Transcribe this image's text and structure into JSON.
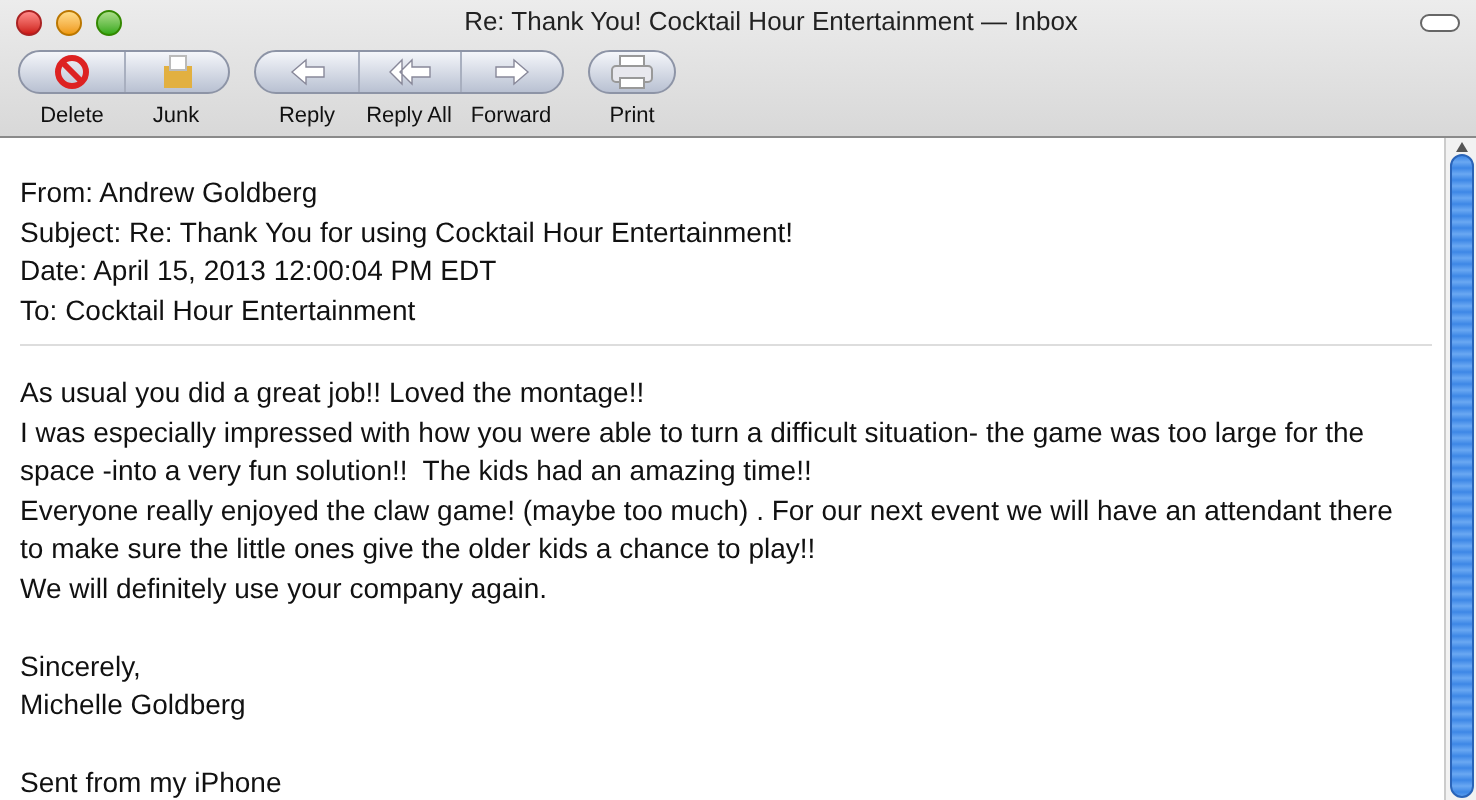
{
  "window": {
    "title": "Re: Thank You! Cocktail Hour Entertainment — Inbox"
  },
  "toolbar": {
    "groups": [
      [
        {
          "label": "Delete",
          "kind": "delete"
        },
        {
          "label": "Junk",
          "kind": "junk"
        }
      ],
      [
        {
          "label": "Reply",
          "kind": "reply"
        },
        {
          "label": "Reply All",
          "kind": "replyall"
        },
        {
          "label": "Forward",
          "kind": "forward"
        }
      ],
      [
        {
          "label": "Print",
          "kind": "print"
        }
      ]
    ]
  },
  "headers": [
    "From: Andrew Goldberg",
    "Subject: Re: Thank You for using Cocktail Hour Entertainment!",
    "Date: April 15, 2013 12:00:04 PM EDT",
    "To: Cocktail Hour Entertainment"
  ],
  "body": [
    [
      "As usual you did a great job!! Loved the montage!!",
      "I was especially impressed with how you were able to turn a difficult situation- the game was too large for the",
      "space -into a very fun solution!!  The kids had an amazing time!!",
      "Everyone really enjoyed the claw game! (maybe too much) . For our next event we will have an attendant there",
      "to make sure the little ones give the older kids a chance to play!!",
      "We will definitely use your company again."
    ],
    [
      "Sincerely,",
      "Michelle Goldberg"
    ],
    [
      "Sent from my iPhone"
    ]
  ]
}
